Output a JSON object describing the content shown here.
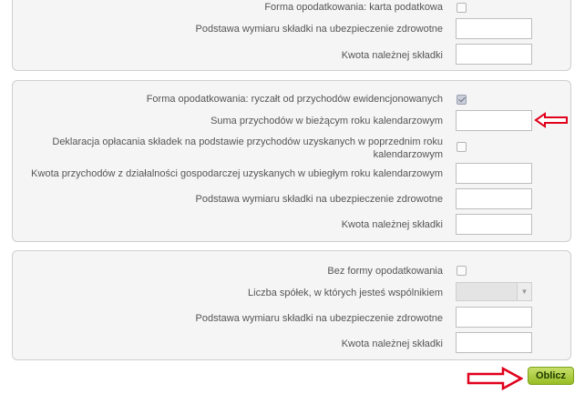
{
  "section1": {
    "taxation_form_label": "Forma opodatkowania: karta podatkowa",
    "taxation_form_checked": false,
    "health_base_label": "Podstawa wymiaru składki na ubezpieczenie zdrowotne",
    "health_base_value": "",
    "contribution_label": "Kwota należnej składki",
    "contribution_value": ""
  },
  "section2": {
    "taxation_form_label": "Forma opodatkowania: ryczałt od przychodów ewidencjonowanych",
    "taxation_form_checked": true,
    "revenue_label": "Suma przychodów w bieżącym roku kalendarzowym",
    "revenue_value": "",
    "declaration_label_line1": "Deklaracja opłacania składek na podstawie przychodów uzyskanych w poprzednim roku",
    "declaration_label_line2": "kalendarzowym",
    "declaration_checked": false,
    "last_year_revenue_label": "Kwota przychodów z działalności gospodarczej uzyskanych w ubiegłym roku kalendarzowym",
    "last_year_revenue_value": "",
    "health_base_label": "Podstawa wymiaru składki na ubezpieczenie zdrowotne",
    "health_base_value": "",
    "contribution_label": "Kwota należnej składki",
    "contribution_value": ""
  },
  "section3": {
    "taxation_form_label": "Bez formy opodatkowania",
    "taxation_form_checked": false,
    "companies_label": "Liczba spółek, w których jesteś wspólnikiem",
    "companies_selected": "",
    "health_base_label": "Podstawa wymiaru składki na ubezpieczenie zdrowotne",
    "health_base_value": "",
    "contribution_label": "Kwota należnej składki",
    "contribution_value": ""
  },
  "actions": {
    "calculate_label": "Oblicz"
  },
  "colors": {
    "annotation_arrow": "#e0001b",
    "calculate_button": "#a8c93a",
    "panel_background": "#f5f5f5"
  }
}
